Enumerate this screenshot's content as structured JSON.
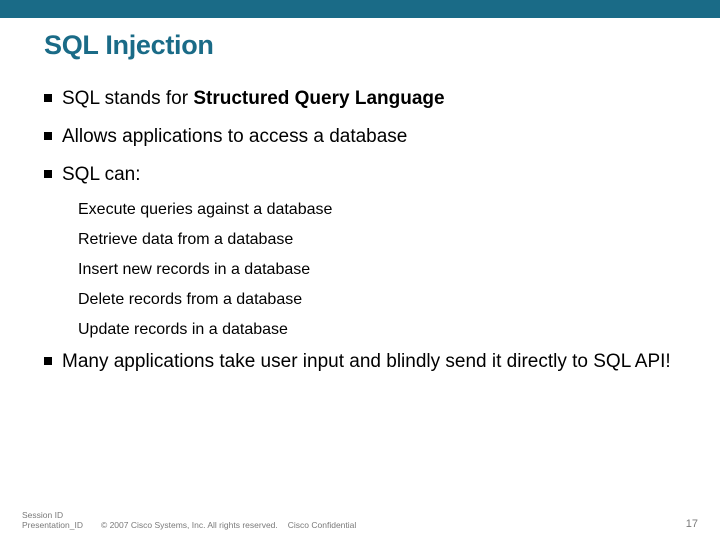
{
  "title": "SQL Injection",
  "bullets": {
    "b1_pre": "SQL stands for ",
    "b1_bold": "Structured Query Language",
    "b2": "Allows applications to access a database",
    "b3": "SQL can:",
    "b4": "Many applications take user input and blindly send it directly to SQL API!"
  },
  "sub": {
    "s1": "Execute queries against a database",
    "s2": "Retrieve data from a database",
    "s3": "Insert new records in a database",
    "s4": "Delete records from a database",
    "s5": "Update records in a database"
  },
  "footer": {
    "left1": "Session ID",
    "left2": "Presentation_ID",
    "copy": "© 2007 Cisco Systems, Inc. All rights reserved.",
    "conf": "Cisco Confidential",
    "page": "17"
  }
}
